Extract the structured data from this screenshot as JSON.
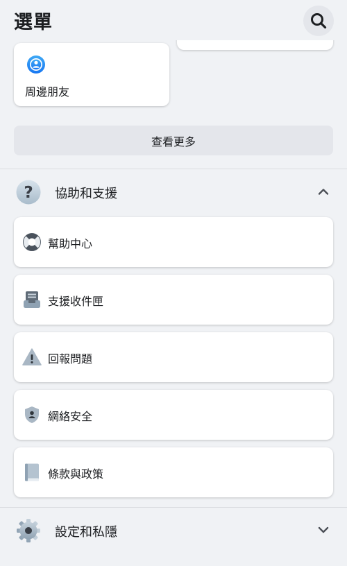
{
  "header": {
    "title": "選單",
    "search_icon": "search-icon"
  },
  "shortcuts": [
    {
      "label": "周邊朋友",
      "icon": "nearby-friends-icon"
    }
  ],
  "see_more_label": "查看更多",
  "help_section": {
    "label": "協助和支援",
    "icon": "question-icon",
    "expanded": true,
    "items": [
      {
        "label": "幫助中心",
        "icon": "lifebuoy-icon"
      },
      {
        "label": "支援收件匣",
        "icon": "inbox-tray-icon"
      },
      {
        "label": "回報問題",
        "icon": "warning-icon"
      },
      {
        "label": "網絡安全",
        "icon": "shield-user-icon"
      },
      {
        "label": "條款與政策",
        "icon": "book-icon"
      }
    ]
  },
  "settings_section": {
    "label": "設定和私隱",
    "icon": "gear-icon",
    "expanded": false
  },
  "colors": {
    "background": "#f0f2f5",
    "card": "#ffffff",
    "button_gray": "#e4e6eb",
    "accent_blue": "#1877f2"
  }
}
